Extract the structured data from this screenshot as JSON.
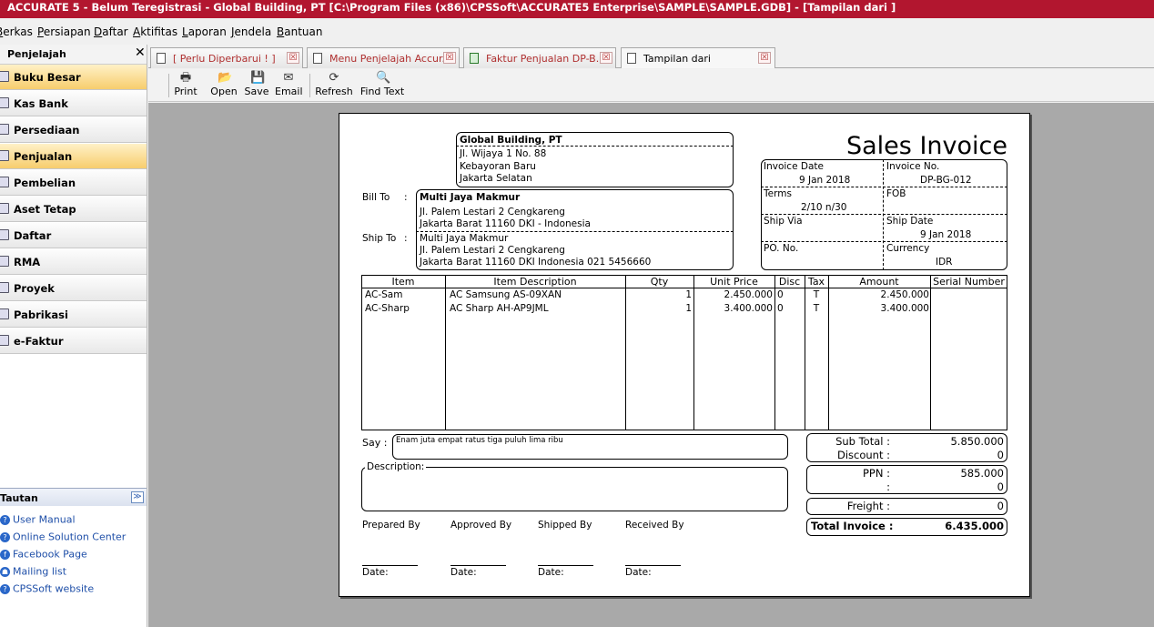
{
  "app_title": "ACCURATE 5  - Belum Teregistrasi - Global Building, PT   [C:\\Program Files (x86)\\CPSSoft\\ACCURATE5 Enterprise\\SAMPLE\\SAMPLE.GDB] - [Tampilan dari ]",
  "menu": [
    "Berkas",
    "Persiapan",
    "Daftar",
    "Aktifitas",
    "Laporan",
    "Jendela",
    "Bantuan"
  ],
  "left_panel": {
    "title": "Penjelajah",
    "close": "✕",
    "items": [
      {
        "label": "Buku Besar",
        "active": true
      },
      {
        "label": "Kas Bank",
        "active": false
      },
      {
        "label": "Persediaan",
        "active": false
      },
      {
        "label": "Penjualan",
        "active": true
      },
      {
        "label": "Pembelian",
        "active": false
      },
      {
        "label": "Aset Tetap",
        "active": false
      },
      {
        "label": "Daftar",
        "active": false
      },
      {
        "label": "RMA",
        "active": false
      },
      {
        "label": "Proyek",
        "active": false
      },
      {
        "label": "Pabrikasi",
        "active": false
      },
      {
        "label": "e-Faktur",
        "active": false
      }
    ],
    "tautan_title": "Tautan",
    "tautan_btn": "≫",
    "links": [
      "User Manual",
      "Online Solution Center",
      "Facebook Page",
      "Mailing list",
      "CPSSoft website"
    ]
  },
  "tabs": [
    {
      "label": "[ Perlu Diperbarui ! ]",
      "color": "#b03030"
    },
    {
      "label": "Menu Penjelajah Accur...",
      "color": "#b03030"
    },
    {
      "label": "Faktur Penjualan DP-B...",
      "color": "#b03030"
    },
    {
      "label": "Tampilan dari",
      "color": "#000000"
    }
  ],
  "tab_close": "☒",
  "toolbar": [
    {
      "label": "Print",
      "icon": "print-icon"
    },
    {
      "label": "Open",
      "icon": "open-icon"
    },
    {
      "label": "Save",
      "icon": "save-icon"
    },
    {
      "label": "Email",
      "icon": "email-icon"
    },
    {
      "label": "Refresh",
      "icon": "refresh-icon"
    },
    {
      "label": "Find Text",
      "icon": "find-icon"
    }
  ],
  "invoice": {
    "heading": "Sales Invoice",
    "company": {
      "name": "Global Building, PT",
      "line1": "Jl. Wijaya 1 No. 88",
      "line2": "Kebayoran Baru",
      "line3": "Jakarta Selatan"
    },
    "bill_to_label": "Bill To",
    "ship_to_label": "Ship To",
    "colon": ":",
    "bill_to": {
      "name": "Multi Jaya Makmur",
      "line1": "Jl. Palem Lestari 2 Cengkareng",
      "line2": "Jakarta Barat 11160 DKI - Indonesia"
    },
    "ship_to": {
      "name": "Multi Jaya Makmur",
      "line1": "Jl. Palem Lestari 2 Cengkareng",
      "line2": "Jakarta Barat 11160 DKI Indonesia 021 5456660"
    },
    "info": {
      "invoice_date_label": "Invoice Date",
      "invoice_date": "9 Jan 2018",
      "invoice_no_label": "Invoice No.",
      "invoice_no": "DP-BG-012",
      "terms_label": "Terms",
      "terms": "2/10 n/30",
      "fob_label": "FOB",
      "fob": "",
      "ship_via_label": "Ship Via",
      "ship_via": "",
      "ship_date_label": "Ship Date",
      "ship_date": "9 Jan 2018",
      "po_no_label": "PO. No.",
      "po_no": "",
      "currency_label": "Currency",
      "currency": "IDR"
    },
    "columns": [
      "Item",
      "Item Description",
      "Qty",
      "Unit Price",
      "Disc",
      "Tax",
      "Amount",
      "Serial Number"
    ],
    "rows": [
      {
        "item": "AC-Sam",
        "desc": "AC Samsung AS-09XAN",
        "qty": "1",
        "price": "2.450.000",
        "disc": "0",
        "tax": "T",
        "amount": "2.450.000",
        "serial": ""
      },
      {
        "item": "AC-Sharp",
        "desc": "AC Sharp AH-AP9JML",
        "qty": "1",
        "price": "3.400.000",
        "disc": "0",
        "tax": "T",
        "amount": "3.400.000",
        "serial": ""
      }
    ],
    "say_label": "Say :",
    "say_text": "Enam juta empat ratus tiga puluh lima ribu",
    "description_label": "Description:",
    "signatures": [
      "Prepared By",
      "Approved By",
      "Shipped By",
      "Received By"
    ],
    "date_label": "Date:",
    "totals": {
      "subtotal_label": "Sub Total :",
      "subtotal": "5.850.000",
      "discount_label": "Discount :",
      "discount": "0",
      "ppn_label": "PPN :",
      "ppn": "585.000",
      "other_label": ":",
      "other": "0",
      "freight_label": "Freight :",
      "freight": "0",
      "total_label": "Total Invoice :",
      "total": "6.435.000"
    }
  }
}
